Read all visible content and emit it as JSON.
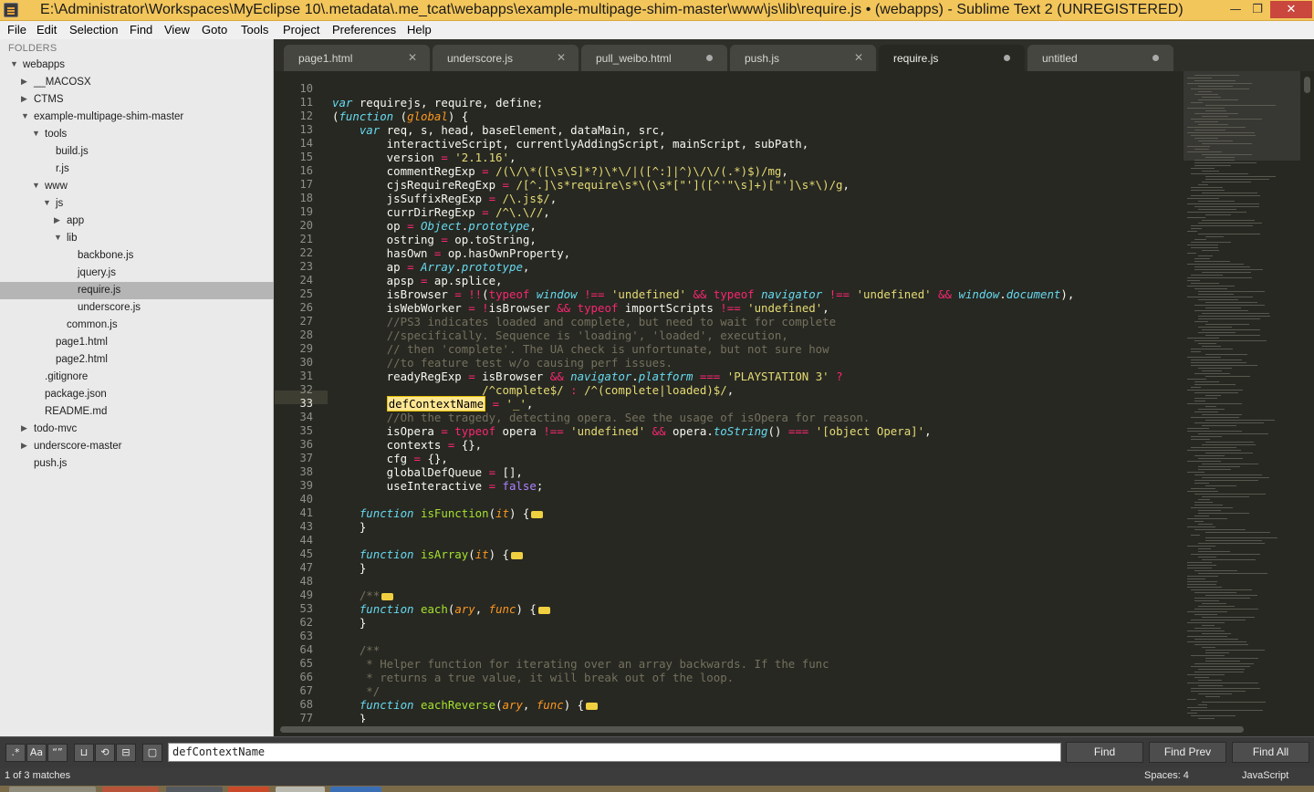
{
  "window": {
    "title": "E:\\Administrator\\Workspaces\\MyEclipse 10\\.metadata\\.me_tcat\\webapps\\example-multipage-shim-master\\www\\js\\lib\\require.js • (webapps) - Sublime Text 2 (UNREGISTERED)",
    "min_glyph": "—",
    "max_glyph": "❐",
    "close_glyph": "✕"
  },
  "menu": [
    "File",
    "Edit",
    "Selection",
    "Find",
    "View",
    "Goto",
    "Tools",
    "Project",
    "Preferences",
    "Help"
  ],
  "sidebar": {
    "header": "FOLDERS",
    "items": [
      {
        "label": "webapps",
        "expanded": true
      },
      {
        "label": "__MACOSX",
        "expanded": false
      },
      {
        "label": "CTMS",
        "expanded": false
      },
      {
        "label": "example-multipage-shim-master",
        "expanded": true
      },
      {
        "label": "tools",
        "expanded": true
      },
      {
        "label": "build.js"
      },
      {
        "label": "r.js"
      },
      {
        "label": "www",
        "expanded": true
      },
      {
        "label": "js",
        "expanded": true
      },
      {
        "label": "app",
        "expanded": false
      },
      {
        "label": "lib",
        "expanded": true
      },
      {
        "label": "backbone.js"
      },
      {
        "label": "jquery.js"
      },
      {
        "label": "require.js",
        "selected": true
      },
      {
        "label": "underscore.js"
      },
      {
        "label": "common.js"
      },
      {
        "label": "page1.html"
      },
      {
        "label": "page2.html"
      },
      {
        "label": ".gitignore"
      },
      {
        "label": "package.json"
      },
      {
        "label": "README.md"
      },
      {
        "label": "todo-mvc",
        "expanded": false
      },
      {
        "label": "underscore-master",
        "expanded": false
      },
      {
        "label": "push.js"
      }
    ]
  },
  "tabs": [
    {
      "label": "page1.html",
      "state": "close"
    },
    {
      "label": "underscore.js",
      "state": "close"
    },
    {
      "label": "pull_weibo.html",
      "state": "dirty"
    },
    {
      "label": "push.js",
      "state": "close"
    },
    {
      "label": "require.js",
      "state": "dirty",
      "active": true
    },
    {
      "label": "untitled",
      "state": "dirty"
    }
  ],
  "editor": {
    "language": "JavaScript",
    "current_line": "33",
    "line_numbers": [
      "10",
      "11",
      "12",
      "13",
      "14",
      "15",
      "16",
      "17",
      "18",
      "19",
      "20",
      "21",
      "22",
      "23",
      "24",
      "25",
      "26",
      "27",
      "28",
      "29",
      "30",
      "31",
      "32",
      "33",
      "34",
      "35",
      "36",
      "37",
      "38",
      "39",
      "40",
      "41",
      "43",
      "44",
      "45",
      "47",
      "48",
      "49",
      "53",
      "62",
      "63",
      "64",
      "65",
      "66",
      "67",
      "68",
      "77"
    ]
  },
  "find": {
    "query": "defContextName",
    "options": [
      "regex",
      "case",
      "whole-word",
      "in-selection",
      "wrap",
      "highlight"
    ],
    "option_glyphs": [
      ".*",
      "Aa",
      "“”",
      "⊔",
      "⟲",
      "⊟",
      "▢"
    ],
    "buttons": {
      "find": "Find",
      "find_prev": "Find Prev",
      "find_all": "Find All"
    }
  },
  "status": {
    "matches": "1 of 3 matches",
    "indent": "Spaces: 4",
    "syntax": "JavaScript"
  },
  "colors": {
    "title_bar": "#f3c65b",
    "editor_bg": "#272822",
    "keyword": "#f92672",
    "string": "#e6db74",
    "comment": "#75715e",
    "storage": "#66d9ef",
    "function": "#a6e22e",
    "number": "#ae81ff",
    "param": "#fd971f"
  }
}
